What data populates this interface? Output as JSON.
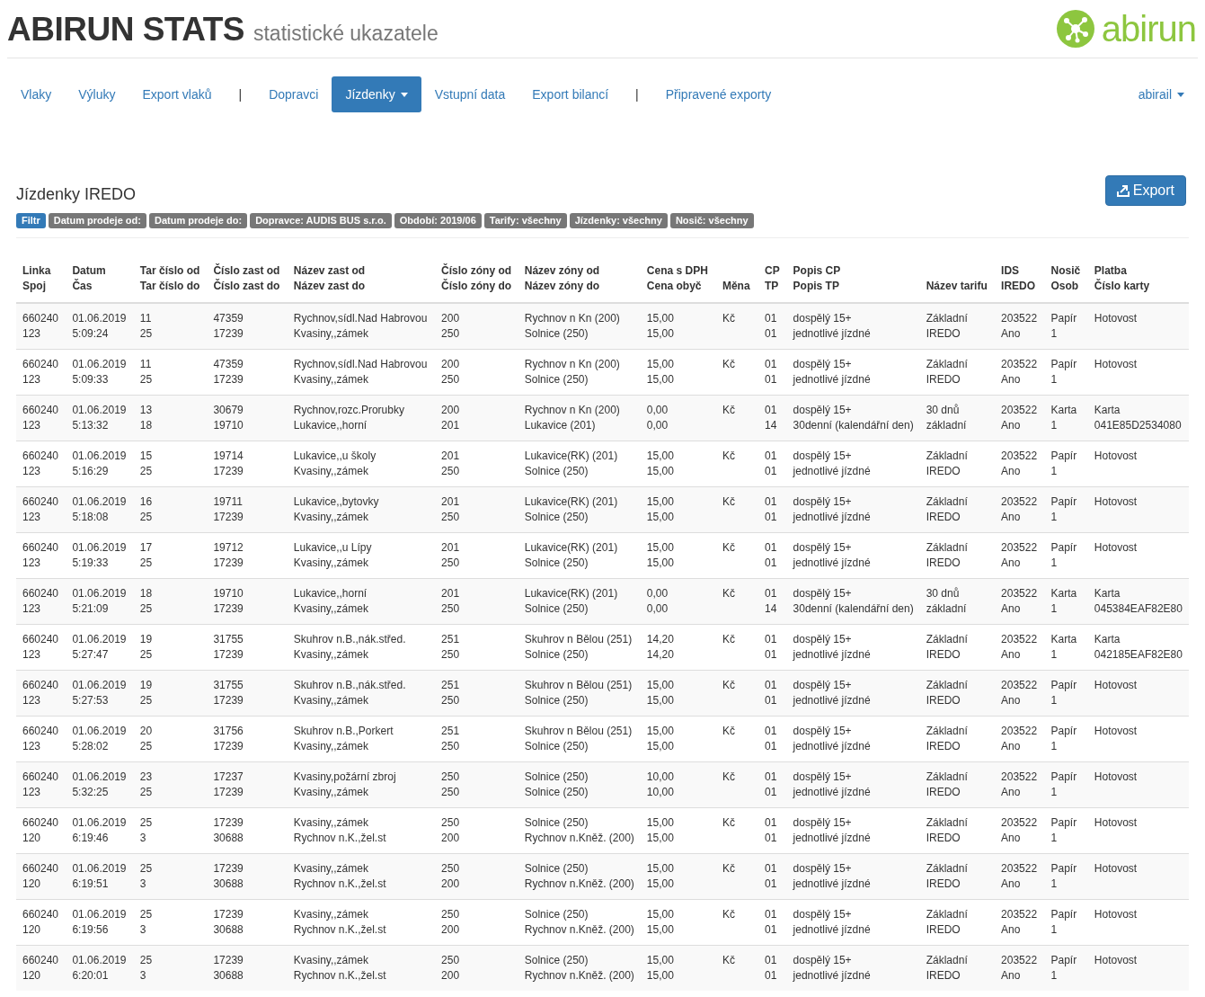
{
  "header": {
    "title": "ABIRUN STATS",
    "subtitle": "statistické ukazatele",
    "logo_text": "abirun"
  },
  "nav": {
    "items": [
      {
        "kind": "link",
        "label": "Vlaky",
        "selected": false,
        "dropdown": false
      },
      {
        "kind": "link",
        "label": "Výluky",
        "selected": false,
        "dropdown": false
      },
      {
        "kind": "link",
        "label": "Export vlaků",
        "selected": false,
        "dropdown": false
      },
      {
        "kind": "separator",
        "label": "|"
      },
      {
        "kind": "link",
        "label": "Dopravci",
        "selected": false,
        "dropdown": false
      },
      {
        "kind": "link",
        "label": "Jízdenky",
        "selected": true,
        "dropdown": true
      },
      {
        "kind": "link",
        "label": "Vstupní data",
        "selected": false,
        "dropdown": false
      },
      {
        "kind": "link",
        "label": "Export bilancí",
        "selected": false,
        "dropdown": false
      },
      {
        "kind": "separator",
        "label": "|"
      },
      {
        "kind": "link",
        "label": "Připravené exporty",
        "selected": false,
        "dropdown": false
      }
    ],
    "user": {
      "label": "abirail",
      "dropdown": true
    }
  },
  "page": {
    "title": "Jízdenky IREDO",
    "export_button": "Export"
  },
  "filters": [
    {
      "kind": "primary",
      "label": "Filtr"
    },
    {
      "kind": "default",
      "label": "Datum prodeje od:"
    },
    {
      "kind": "default",
      "label": "Datum prodeje do:"
    },
    {
      "kind": "default",
      "label": "Dopravce: AUDIS BUS s.r.o."
    },
    {
      "kind": "default",
      "label": "Období: 2019/06"
    },
    {
      "kind": "default",
      "label": "Tarify: všechny"
    },
    {
      "kind": "default",
      "label": "Jízdenky: všechny"
    },
    {
      "kind": "default",
      "label": "Nosič: všechny"
    }
  ],
  "table": {
    "columns": [
      {
        "top": "Linka",
        "bottom": "Spoj"
      },
      {
        "top": "Datum",
        "bottom": "Čas"
      },
      {
        "top": "Tar číslo od",
        "bottom": "Tar číslo do"
      },
      {
        "top": "Číslo zast od",
        "bottom": "Číslo zast do"
      },
      {
        "top": "Název zast od",
        "bottom": "Název zast do"
      },
      {
        "top": "Číslo zóny od",
        "bottom": "Číslo zóny do"
      },
      {
        "top": "Název zóny od",
        "bottom": "Název zóny do"
      },
      {
        "top": "Cena s DPH",
        "bottom": "Cena obyč"
      },
      {
        "bottom": "Měna"
      },
      {
        "top": "CP",
        "bottom": "TP"
      },
      {
        "top": "Popis CP",
        "bottom": "Popis TP"
      },
      {
        "bottom": "Název tarifu"
      },
      {
        "top": "IDS",
        "bottom": "IREDO"
      },
      {
        "top": "Nosič",
        "bottom": "Osob"
      },
      {
        "top": "Platba",
        "bottom": "Číslo karty"
      }
    ],
    "rows": [
      [
        [
          "660240",
          "123"
        ],
        [
          "01.06.2019",
          "5:09:24"
        ],
        [
          "11",
          "25"
        ],
        [
          "47359",
          "17239"
        ],
        [
          "Rychnov,sídl.Nad Habrovou",
          "Kvasiny,,zámek"
        ],
        [
          "200",
          "250"
        ],
        [
          "Rychnov n Kn (200)",
          "Solnice (250)"
        ],
        [
          "15,00",
          "15,00"
        ],
        [
          "Kč"
        ],
        [
          "01",
          "01"
        ],
        [
          "dospělý 15+",
          "jednotlivé jízdné"
        ],
        [
          "Základní",
          "IREDO"
        ],
        [
          "203522",
          "Ano"
        ],
        [
          "Papír",
          "1"
        ],
        [
          "Hotovost"
        ]
      ],
      [
        [
          "660240",
          "123"
        ],
        [
          "01.06.2019",
          "5:09:33"
        ],
        [
          "11",
          "25"
        ],
        [
          "47359",
          "17239"
        ],
        [
          "Rychnov,sídl.Nad Habrovou",
          "Kvasiny,,zámek"
        ],
        [
          "200",
          "250"
        ],
        [
          "Rychnov n Kn (200)",
          "Solnice (250)"
        ],
        [
          "15,00",
          "15,00"
        ],
        [
          "Kč"
        ],
        [
          "01",
          "01"
        ],
        [
          "dospělý 15+",
          "jednotlivé jízdné"
        ],
        [
          "Základní",
          "IREDO"
        ],
        [
          "203522",
          "Ano"
        ],
        [
          "Papír",
          "1"
        ],
        [
          "Hotovost"
        ]
      ],
      [
        [
          "660240",
          "123"
        ],
        [
          "01.06.2019",
          "5:13:32"
        ],
        [
          "13",
          "18"
        ],
        [
          "30679",
          "19710"
        ],
        [
          "Rychnov,rozc.Prorubky",
          "Lukavice,,horní"
        ],
        [
          "200",
          "201"
        ],
        [
          "Rychnov n Kn (200)",
          "Lukavice (201)"
        ],
        [
          "0,00",
          "0,00"
        ],
        [
          "Kč"
        ],
        [
          "01",
          "14"
        ],
        [
          "dospělý 15+",
          "30denní (kalendářní den)"
        ],
        [
          "30 dnů",
          "základní"
        ],
        [
          "203522",
          "Ano"
        ],
        [
          "Karta",
          "1"
        ],
        [
          "Karta",
          "041E85D2534080"
        ]
      ],
      [
        [
          "660240",
          "123"
        ],
        [
          "01.06.2019",
          "5:16:29"
        ],
        [
          "15",
          "25"
        ],
        [
          "19714",
          "17239"
        ],
        [
          "Lukavice,,u školy",
          "Kvasiny,,zámek"
        ],
        [
          "201",
          "250"
        ],
        [
          "Lukavice(RK) (201)",
          "Solnice (250)"
        ],
        [
          "15,00",
          "15,00"
        ],
        [
          "Kč"
        ],
        [
          "01",
          "01"
        ],
        [
          "dospělý 15+",
          "jednotlivé jízdné"
        ],
        [
          "Základní",
          "IREDO"
        ],
        [
          "203522",
          "Ano"
        ],
        [
          "Papír",
          "1"
        ],
        [
          "Hotovost"
        ]
      ],
      [
        [
          "660240",
          "123"
        ],
        [
          "01.06.2019",
          "5:18:08"
        ],
        [
          "16",
          "25"
        ],
        [
          "19711",
          "17239"
        ],
        [
          "Lukavice,,bytovky",
          "Kvasiny,,zámek"
        ],
        [
          "201",
          "250"
        ],
        [
          "Lukavice(RK) (201)",
          "Solnice (250)"
        ],
        [
          "15,00",
          "15,00"
        ],
        [
          "Kč"
        ],
        [
          "01",
          "01"
        ],
        [
          "dospělý 15+",
          "jednotlivé jízdné"
        ],
        [
          "Základní",
          "IREDO"
        ],
        [
          "203522",
          "Ano"
        ],
        [
          "Papír",
          "1"
        ],
        [
          "Hotovost"
        ]
      ],
      [
        [
          "660240",
          "123"
        ],
        [
          "01.06.2019",
          "5:19:33"
        ],
        [
          "17",
          "25"
        ],
        [
          "19712",
          "17239"
        ],
        [
          "Lukavice,,u Lípy",
          "Kvasiny,,zámek"
        ],
        [
          "201",
          "250"
        ],
        [
          "Lukavice(RK) (201)",
          "Solnice (250)"
        ],
        [
          "15,00",
          "15,00"
        ],
        [
          "Kč"
        ],
        [
          "01",
          "01"
        ],
        [
          "dospělý 15+",
          "jednotlivé jízdné"
        ],
        [
          "Základní",
          "IREDO"
        ],
        [
          "203522",
          "Ano"
        ],
        [
          "Papír",
          "1"
        ],
        [
          "Hotovost"
        ]
      ],
      [
        [
          "660240",
          "123"
        ],
        [
          "01.06.2019",
          "5:21:09"
        ],
        [
          "18",
          "25"
        ],
        [
          "19710",
          "17239"
        ],
        [
          "Lukavice,,horní",
          "Kvasiny,,zámek"
        ],
        [
          "201",
          "250"
        ],
        [
          "Lukavice(RK) (201)",
          "Solnice (250)"
        ],
        [
          "0,00",
          "0,00"
        ],
        [
          "Kč"
        ],
        [
          "01",
          "14"
        ],
        [
          "dospělý 15+",
          "30denní (kalendářní den)"
        ],
        [
          "30 dnů",
          "základní"
        ],
        [
          "203522",
          "Ano"
        ],
        [
          "Karta",
          "1"
        ],
        [
          "Karta",
          "045384EAF82E80"
        ]
      ],
      [
        [
          "660240",
          "123"
        ],
        [
          "01.06.2019",
          "5:27:47"
        ],
        [
          "19",
          "25"
        ],
        [
          "31755",
          "17239"
        ],
        [
          "Skuhrov n.B.,nák.střed.",
          "Kvasiny,,zámek"
        ],
        [
          "251",
          "250"
        ],
        [
          "Skuhrov n Bělou (251)",
          "Solnice (250)"
        ],
        [
          "14,20",
          "14,20"
        ],
        [
          "Kč"
        ],
        [
          "01",
          "01"
        ],
        [
          "dospělý 15+",
          "jednotlivé jízdné"
        ],
        [
          "Základní",
          "IREDO"
        ],
        [
          "203522",
          "Ano"
        ],
        [
          "Karta",
          "1"
        ],
        [
          "Karta",
          "042185EAF82E80"
        ]
      ],
      [
        [
          "660240",
          "123"
        ],
        [
          "01.06.2019",
          "5:27:53"
        ],
        [
          "19",
          "25"
        ],
        [
          "31755",
          "17239"
        ],
        [
          "Skuhrov n.B.,nák.střed.",
          "Kvasiny,,zámek"
        ],
        [
          "251",
          "250"
        ],
        [
          "Skuhrov n Bělou (251)",
          "Solnice (250)"
        ],
        [
          "15,00",
          "15,00"
        ],
        [
          "Kč"
        ],
        [
          "01",
          "01"
        ],
        [
          "dospělý 15+",
          "jednotlivé jízdné"
        ],
        [
          "Základní",
          "IREDO"
        ],
        [
          "203522",
          "Ano"
        ],
        [
          "Papír",
          "1"
        ],
        [
          "Hotovost"
        ]
      ],
      [
        [
          "660240",
          "123"
        ],
        [
          "01.06.2019",
          "5:28:02"
        ],
        [
          "20",
          "25"
        ],
        [
          "31756",
          "17239"
        ],
        [
          "Skuhrov n.B.,Porkert",
          "Kvasiny,,zámek"
        ],
        [
          "251",
          "250"
        ],
        [
          "Skuhrov n Bělou (251)",
          "Solnice (250)"
        ],
        [
          "15,00",
          "15,00"
        ],
        [
          "Kč"
        ],
        [
          "01",
          "01"
        ],
        [
          "dospělý 15+",
          "jednotlivé jízdné"
        ],
        [
          "Základní",
          "IREDO"
        ],
        [
          "203522",
          "Ano"
        ],
        [
          "Papír",
          "1"
        ],
        [
          "Hotovost"
        ]
      ],
      [
        [
          "660240",
          "123"
        ],
        [
          "01.06.2019",
          "5:32:25"
        ],
        [
          "23",
          "25"
        ],
        [
          "17237",
          "17239"
        ],
        [
          "Kvasiny,požární zbroj",
          "Kvasiny,,zámek"
        ],
        [
          "250",
          "250"
        ],
        [
          "Solnice (250)",
          "Solnice (250)"
        ],
        [
          "10,00",
          "10,00"
        ],
        [
          "Kč"
        ],
        [
          "01",
          "01"
        ],
        [
          "dospělý 15+",
          "jednotlivé jízdné"
        ],
        [
          "Základní",
          "IREDO"
        ],
        [
          "203522",
          "Ano"
        ],
        [
          "Papír",
          "1"
        ],
        [
          "Hotovost"
        ]
      ],
      [
        [
          "660240",
          "120"
        ],
        [
          "01.06.2019",
          "6:19:46"
        ],
        [
          "25",
          "3"
        ],
        [
          "17239",
          "30688"
        ],
        [
          "Kvasiny,,zámek",
          "Rychnov n.K.,žel.st"
        ],
        [
          "250",
          "200"
        ],
        [
          "Solnice (250)",
          "Rychnov n.Kněž. (200)"
        ],
        [
          "15,00",
          "15,00"
        ],
        [
          "Kč"
        ],
        [
          "01",
          "01"
        ],
        [
          "dospělý 15+",
          "jednotlivé jízdné"
        ],
        [
          "Základní",
          "IREDO"
        ],
        [
          "203522",
          "Ano"
        ],
        [
          "Papír",
          "1"
        ],
        [
          "Hotovost"
        ]
      ],
      [
        [
          "660240",
          "120"
        ],
        [
          "01.06.2019",
          "6:19:51"
        ],
        [
          "25",
          "3"
        ],
        [
          "17239",
          "30688"
        ],
        [
          "Kvasiny,,zámek",
          "Rychnov n.K.,žel.st"
        ],
        [
          "250",
          "200"
        ],
        [
          "Solnice (250)",
          "Rychnov n.Kněž. (200)"
        ],
        [
          "15,00",
          "15,00"
        ],
        [
          "Kč"
        ],
        [
          "01",
          "01"
        ],
        [
          "dospělý 15+",
          "jednotlivé jízdné"
        ],
        [
          "Základní",
          "IREDO"
        ],
        [
          "203522",
          "Ano"
        ],
        [
          "Papír",
          "1"
        ],
        [
          "Hotovost"
        ]
      ],
      [
        [
          "660240",
          "120"
        ],
        [
          "01.06.2019",
          "6:19:56"
        ],
        [
          "25",
          "3"
        ],
        [
          "17239",
          "30688"
        ],
        [
          "Kvasiny,,zámek",
          "Rychnov n.K.,žel.st"
        ],
        [
          "250",
          "200"
        ],
        [
          "Solnice (250)",
          "Rychnov n.Kněž. (200)"
        ],
        [
          "15,00",
          "15,00"
        ],
        [
          "Kč"
        ],
        [
          "01",
          "01"
        ],
        [
          "dospělý 15+",
          "jednotlivé jízdné"
        ],
        [
          "Základní",
          "IREDO"
        ],
        [
          "203522",
          "Ano"
        ],
        [
          "Papír",
          "1"
        ],
        [
          "Hotovost"
        ]
      ],
      [
        [
          "660240",
          "120"
        ],
        [
          "01.06.2019",
          "6:20:01"
        ],
        [
          "25",
          "3"
        ],
        [
          "17239",
          "30688"
        ],
        [
          "Kvasiny,,zámek",
          "Rychnov n.K.,žel.st"
        ],
        [
          "250",
          "200"
        ],
        [
          "Solnice (250)",
          "Rychnov n.Kněž. (200)"
        ],
        [
          "15,00",
          "15,00"
        ],
        [
          "Kč"
        ],
        [
          "01",
          "01"
        ],
        [
          "dospělý 15+",
          "jednotlivé jízdné"
        ],
        [
          "Základní",
          "IREDO"
        ],
        [
          "203522",
          "Ano"
        ],
        [
          "Papír",
          "1"
        ],
        [
          "Hotovost"
        ]
      ]
    ]
  }
}
